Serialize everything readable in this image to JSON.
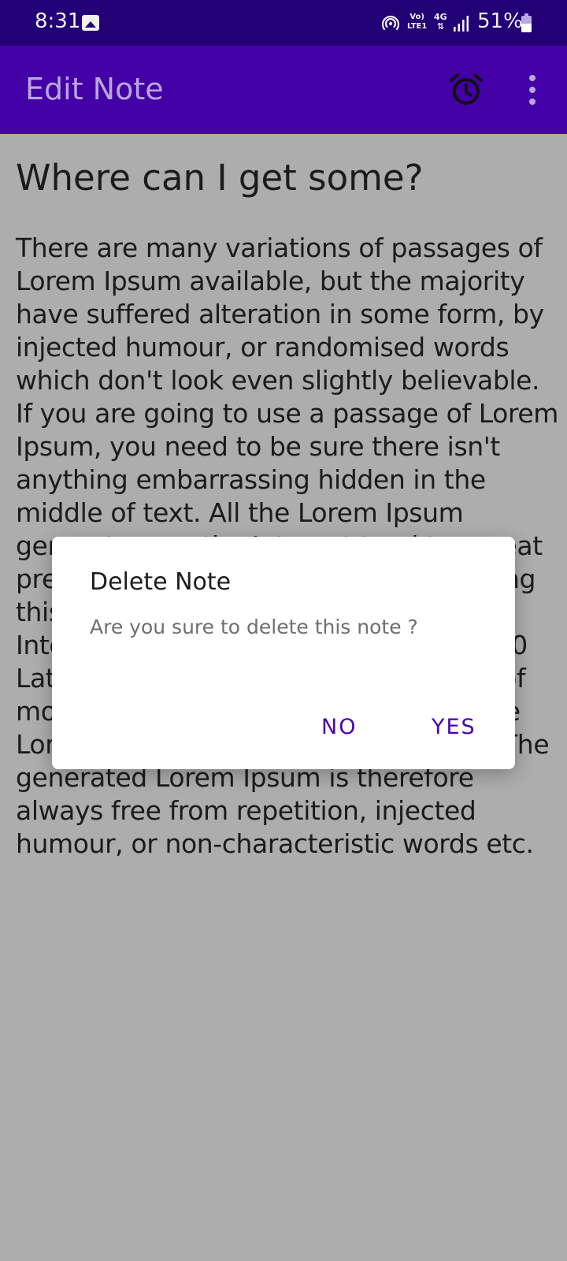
{
  "status_bar": {
    "time": "8:31",
    "volte_line1": "Vo)",
    "volte_line2": "LTE1",
    "network": "4G",
    "battery": "51%",
    "icons": [
      "gallery-icon",
      "hotspot-icon",
      "volte-icon",
      "data-arrows-icon",
      "signal-icon",
      "battery-icon"
    ]
  },
  "app_bar": {
    "title": "Edit Note",
    "actions": [
      "alarm-icon",
      "more-vert-icon"
    ]
  },
  "note": {
    "title": "Where can I get some?",
    "body": "There are many variations of passages of Lorem Ipsum available, but the majority have suffered alteration in some form, by injected humour, or randomised words which don't look even slightly believable. If you are going to use a passage of Lorem Ipsum, you need to be sure there isn't anything embarrassing hidden in the middle of text. All the Lorem Ipsum generators on the Internet tend to repeat predefined chunks as necessary, making this the first true generator on the Internet. It uses a dictionary of over 200 Latin words, combined with a handful of model sentence structures, to generate Lorem Ipsum which looks reasonable. The generated Lorem Ipsum is therefore always free from repetition, injected humour, or non-characteristic words etc."
  },
  "dialog": {
    "title": "Delete Note",
    "message": "Are you sure to delete this note ?",
    "no_label": "NO",
    "yes_label": "YES"
  },
  "colors": {
    "status_bar": "#220075",
    "app_bar": "#4200a6",
    "scrim_background": "#adadad",
    "accent": "#4a00b4"
  }
}
